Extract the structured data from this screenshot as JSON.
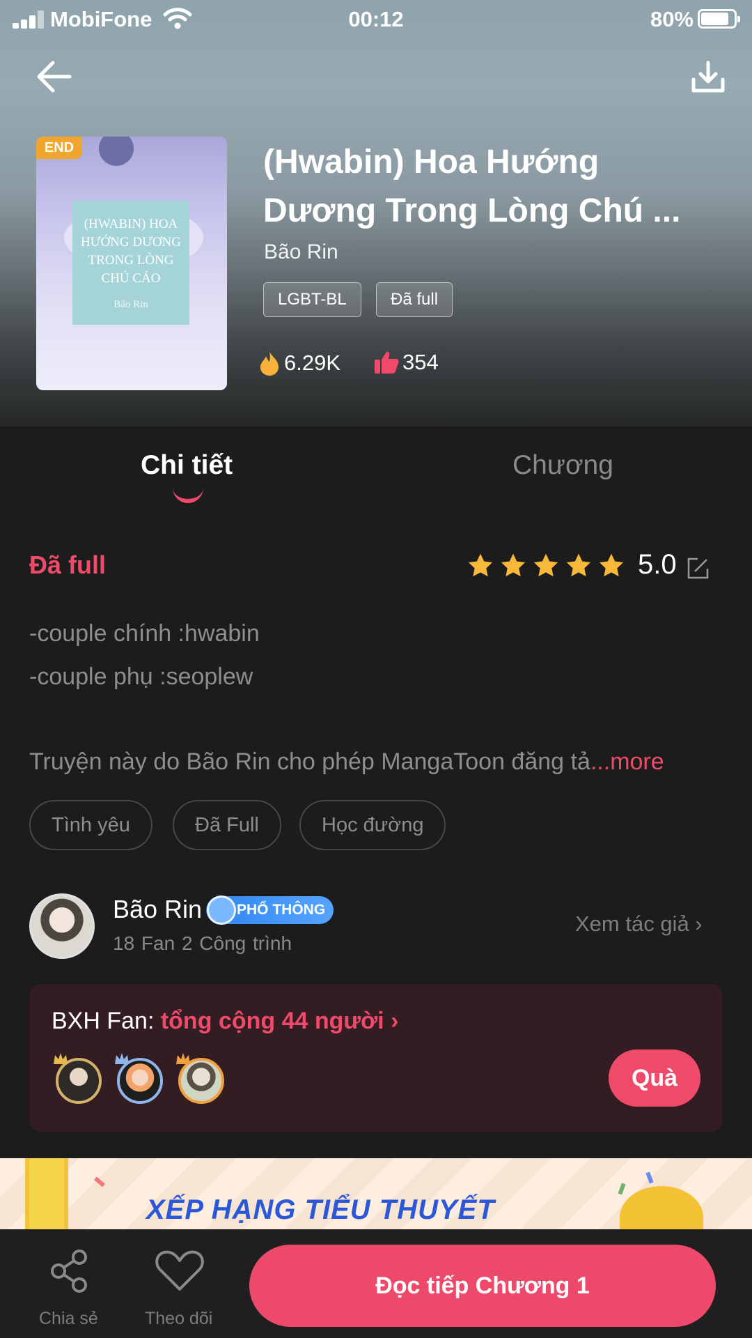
{
  "status_bar": {
    "carrier": "MobiFone",
    "time": "00:12",
    "battery": "80%"
  },
  "book": {
    "title": "(Hwabin) Hoa Hướng Dương Trong Lòng Chú ...",
    "author": "Bão Rin",
    "end_badge": "END",
    "cover_title": "(HWABIN) HOA HƯỚNG DƯƠNG TRONG LÒNG CHÚ CÁO",
    "cover_author": "Bão Rin",
    "tags": [
      "LGBT-BL",
      "Đã full"
    ],
    "views": "6.29K",
    "likes": "354"
  },
  "tabs": {
    "active": "Chi tiết",
    "inactive": "Chương"
  },
  "detail": {
    "status": "Đã full",
    "rating": "5.0",
    "stars": 5,
    "desc_line1": "-couple chính :hwabin",
    "desc_line2": "-couple phụ :seoplew",
    "desc_line3": "Truyện này do Bão Rin cho phép MangaToon đăng tả",
    "more": "...more",
    "chips": [
      "Tình yêu",
      "Đã Full",
      "Học đường"
    ]
  },
  "author": {
    "name": "Bão Rin",
    "level": "PHỔ THÔNG",
    "stats": "18 Fan   2 Công trình",
    "link": "Xem tác giả ›"
  },
  "fan_board": {
    "label": "BXH Fan: ",
    "count": "tổng cộng 44 người ›",
    "gift": "Quà"
  },
  "banner": {
    "text": "XẾP HẠNG TIỂU THUYẾT"
  },
  "bottom_bar": {
    "share": "Chia sẻ",
    "follow": "Theo dõi",
    "read": "Đọc tiếp Chương 1"
  },
  "colors": {
    "accent": "#f04a6a",
    "star": "#f6b93a",
    "badge": "#2e86f0"
  }
}
